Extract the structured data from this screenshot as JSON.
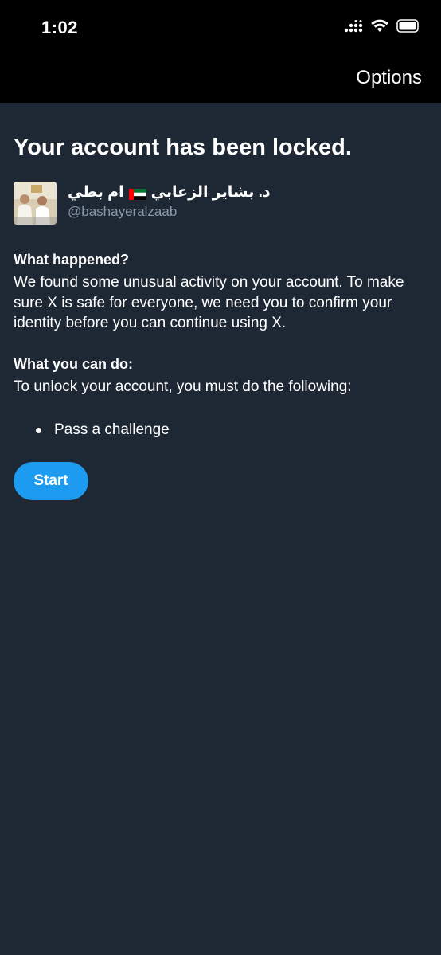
{
  "status_bar": {
    "time": "1:02",
    "icons": [
      "signal-icon",
      "wifi-icon",
      "battery-icon"
    ]
  },
  "nav": {
    "options_label": "Options"
  },
  "page": {
    "title": "Your account has been locked."
  },
  "account": {
    "display_name": "د. بشاير الزعابي",
    "name_suffix": "ام بطي",
    "handle": "@bashayeralzaab"
  },
  "what_happened": {
    "heading": "What happened?",
    "text": "We found some unusual activity on your account. To make sure X is safe for everyone, we need you to confirm your identity before you can continue using X."
  },
  "what_you_can_do": {
    "heading": "What you can do:",
    "text": "To unlock your account, you must do the following:",
    "items": [
      "Pass a challenge"
    ]
  },
  "actions": {
    "start_label": "Start"
  },
  "colors": {
    "background": "#1e2835",
    "top_bar": "#000000",
    "accent": "#1d9bf0",
    "secondary_text": "#8899a6"
  }
}
